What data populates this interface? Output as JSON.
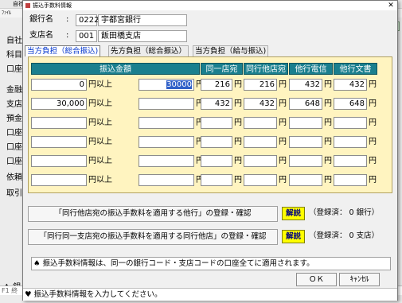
{
  "background": {
    "title_fragment": "自社",
    "menu_fragment": "ﾌｧｲﾙ",
    "left_labels": [
      "自社",
      "科目",
      "口座",
      "金融",
      "支店",
      "預金",
      "口座",
      "口座",
      "口座",
      "依頼",
      "取引"
    ],
    "bottom_left": "♠ 銀",
    "bottom_statusbar": "F1 終"
  },
  "dialog": {
    "title": "振込手数料情報",
    "close_glyph": "✕",
    "bank": {
      "label": "銀行名",
      "code": "0222",
      "name": "宇都宮銀行"
    },
    "branch": {
      "label": "支店名",
      "code": "001",
      "name": "飯田橋支店"
    },
    "colon": ":",
    "tabs": [
      "当方負担（総合振込)",
      "先方負担（総合振込）",
      "当方負担（給与振込)"
    ],
    "active_tab": 0,
    "table": {
      "headers": [
        "振込金額",
        "同一店宛",
        "同行他店宛",
        "他行電信",
        "他行文書"
      ],
      "unit_yen": "円",
      "unit_over": "円以上",
      "unit_under": "円未満",
      "rows": [
        {
          "from": "0",
          "to": "30000",
          "fees": [
            "216",
            "216",
            "432",
            "432"
          ]
        },
        {
          "from": "30,000",
          "to": "",
          "fees": [
            "432",
            "432",
            "648",
            "648"
          ]
        },
        {
          "from": "",
          "to": "",
          "fees": [
            "",
            "",
            "",
            ""
          ]
        },
        {
          "from": "",
          "to": "",
          "fees": [
            "",
            "",
            "",
            ""
          ]
        },
        {
          "from": "",
          "to": "",
          "fees": [
            "",
            "",
            "",
            ""
          ]
        },
        {
          "from": "",
          "to": "",
          "fees": [
            "",
            "",
            "",
            ""
          ]
        }
      ]
    },
    "action1": {
      "label": "「同行他店宛の振込手数料を適用する他行」の登録・確認",
      "help": "解説",
      "status": "（登録済：  0 銀行）"
    },
    "action2": {
      "label": "「同行同一支店宛の振込手数料を適用する同行他店」の登録・確認",
      "help": "解説",
      "status": "（登録済：  0 支店）"
    },
    "info": "♠ 振込手数料情報は、同一の銀行コード・支店コードの口座全てに適用されます。",
    "ok": "ＯＫ",
    "cancel": "ｷｬﾝｾﾙ",
    "status_message": "♥ 振込手数料情報を入力してください。"
  }
}
